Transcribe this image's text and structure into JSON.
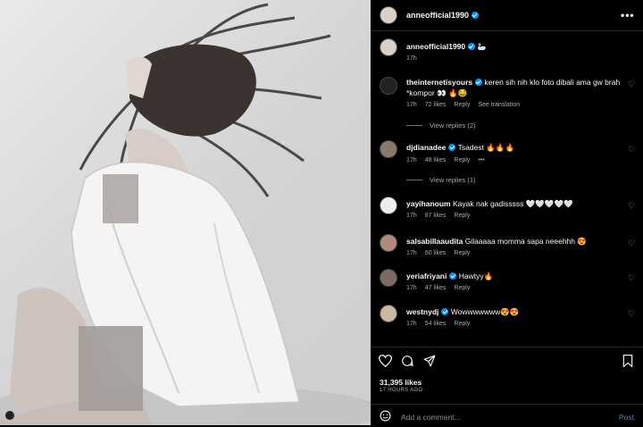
{
  "post": {
    "author": "anneofficial1990",
    "caption_emoji": "🦢",
    "caption_time": "17h",
    "likes": "31,395 likes",
    "time_ago": "17 HOURS AGO"
  },
  "comments": [
    {
      "user": "theinternetisyours",
      "text": "keren sih nih klo foto dibali ama gw brah *kompor 👀 🔥😂",
      "time": "17h",
      "likes": "72 likes",
      "reply": "Reply",
      "extra": "See translation",
      "replies": "View replies (2)"
    },
    {
      "user": "djdianadee",
      "text": "Tsadest 🔥🔥🔥",
      "time": "17h",
      "likes": "48 likes",
      "reply": "Reply",
      "extra": "•••",
      "replies": "View replies (1)"
    },
    {
      "user": "yayihanoum",
      "text": "Kayak nak gadisssss 🤍🤍🤍🤍🤍",
      "time": "17h",
      "likes": "87 likes",
      "reply": "Reply"
    },
    {
      "user": "salsabillaaudita",
      "text": "Gilaaaaa momma sapa neeehhh 😍",
      "time": "17h",
      "likes": "60 likes",
      "reply": "Reply"
    },
    {
      "user": "yeriafriyani",
      "text": "Hawtyy🔥",
      "time": "17h",
      "likes": "47 likes",
      "reply": "Reply"
    },
    {
      "user": "westnydj",
      "text": "Wowwwwwww😍😍",
      "time": "17h",
      "likes": "54 likes",
      "reply": "Reply"
    }
  ],
  "composer": {
    "placeholder": "Add a comment...",
    "post_label": "Post"
  },
  "icons": {
    "like": "heart-icon",
    "comment": "comment-icon",
    "share": "share-icon",
    "save": "bookmark-icon",
    "emoji": "emoji-icon"
  },
  "colors": {
    "verified": "#0095f6",
    "background": "#000000",
    "muted": "#a8a8a8"
  }
}
